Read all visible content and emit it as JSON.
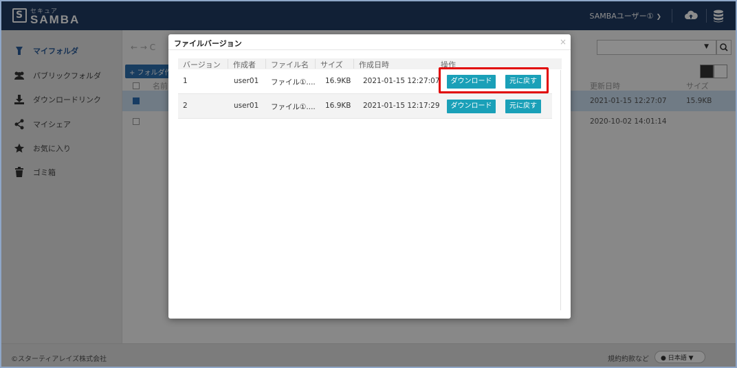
{
  "header": {
    "logo_sub": "セキュア",
    "logo_main": "SAMBA",
    "logo_mark": "S",
    "user_name": "SAMBAユーザー①"
  },
  "sidebar": {
    "items": [
      {
        "label": "マイフォルダ",
        "icon": "my-folder-icon"
      },
      {
        "label": "パブリックフォルダ",
        "icon": "group-icon"
      },
      {
        "label": "ダウンロードリンク",
        "icon": "download-icon"
      },
      {
        "label": "マイシェア",
        "icon": "share-icon"
      },
      {
        "label": "お気に入り",
        "icon": "star-icon"
      },
      {
        "label": "ゴミ箱",
        "icon": "trash-icon"
      }
    ]
  },
  "main": {
    "add_folder_label": "+ フォルダ作",
    "col_name": "名前",
    "col_updated": "更新日時",
    "col_size": "サイズ",
    "rows": [
      {
        "updated": "2021-01-15 12:27:07",
        "size": "15.9KB",
        "checked": true
      },
      {
        "updated": "2020-10-02 14:01:14",
        "size": "",
        "checked": false
      }
    ]
  },
  "modal": {
    "title": "ファイルバージョン",
    "close": "×",
    "columns": [
      "バージョン",
      "作成者",
      "ファイル名",
      "サイズ",
      "作成日時",
      "操作"
    ],
    "rows": [
      {
        "version": "1",
        "creator": "user01",
        "filename": "ファイル①....",
        "size": "16.9KB",
        "created": "2021-01-15 12:27:07"
      },
      {
        "version": "2",
        "creator": "user01",
        "filename": "ファイル①....",
        "size": "16.9KB",
        "created": "2021-01-15 12:17:29"
      }
    ],
    "download_label": "ダウンロード",
    "restore_label": "元に戻す"
  },
  "footer": {
    "copyright": "©スターティアレイズ株式会社",
    "terms": "規約約款など",
    "language": "日本語"
  },
  "colors": {
    "header_bg": "#1f3b63",
    "button_teal": "#1aa0b8",
    "highlight_red": "#e10000",
    "selected_row": "#cde0f2"
  }
}
